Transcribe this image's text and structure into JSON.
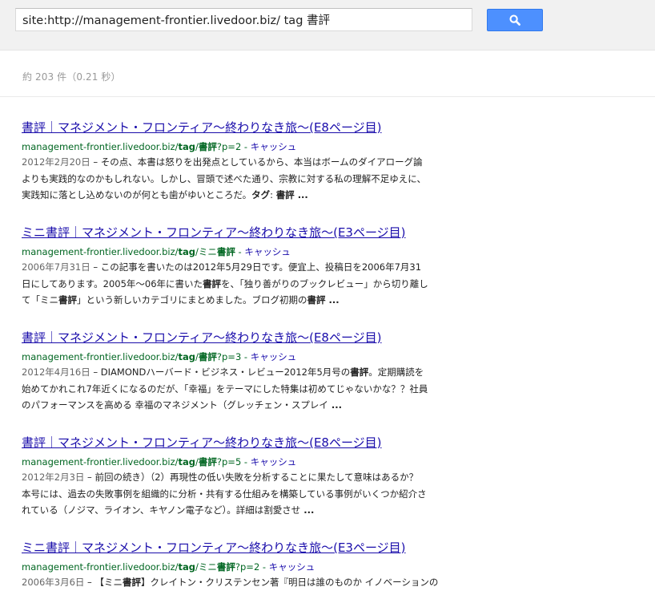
{
  "search": {
    "query": "site:http://management-frontier.livedoor.biz/ tag 書評",
    "button_icon": "search-icon"
  },
  "stats": {
    "text": "約 203 件（0.21 秒）"
  },
  "colors": {
    "link": "#1a0dab",
    "url": "#006621",
    "button": "#4d90fe"
  },
  "results": [
    {
      "title": "書評｜マネジメント・フロンティア～終わりなき旅～(E8ページ目)",
      "url_pre": "management-frontier.livedoor.biz/",
      "url_bold1": "tag",
      "url_mid": "/",
      "url_bold2": "書評",
      "url_post": "?p=2",
      "url_sep": " - ",
      "cache": "キャッシュ",
      "date": "2012年2月20日",
      "snippet_a": " – その点、本書は怒りを出発点としているから、本当はボームのダイアローグ論よりも実践的なのかもしれない。しかし、冒頭で述べた通り、宗教に対する私の理解不足ゆえに、実践知に落とし込めないのが何とも歯がゆいところだ。",
      "bold_a": "タグ",
      "snippet_b": ": ",
      "bold_b": "書評",
      "snippet_c": " ..."
    },
    {
      "title": "ミニ書評｜マネジメント・フロンティア～終わりなき旅～(E3ページ目)",
      "url_pre": "management-frontier.livedoor.biz/",
      "url_bold1": "tag",
      "url_mid": "/ミニ",
      "url_bold2": "書評",
      "url_post": "",
      "url_sep": " - ",
      "cache": "キャッシュ",
      "date": "2006年7月31日",
      "snippet_a": " – この記事を書いたのは2012年5月29日です。便宜上、投稿日を2006年7月31日にしてあります。2005年～06年に書いた",
      "bold_a": "書評",
      "snippet_b": "を、「独り善がりのブックレビュー」から切り離して「ミニ",
      "bold_b": "書評",
      "snippet_c": "」という新しいカテゴリにまとめました。ブログ初期の",
      "bold_c": "書評",
      "snippet_d": " ..."
    },
    {
      "title": "書評｜マネジメント・フロンティア～終わりなき旅～(E8ページ目)",
      "url_pre": "management-frontier.livedoor.biz/",
      "url_bold1": "tag",
      "url_mid": "/",
      "url_bold2": "書評",
      "url_post": "?p=3",
      "url_sep": " - ",
      "cache": "キャッシュ",
      "date": "2012年4月16日",
      "snippet_a": " – DIAMONDハーバード・ビジネス・レビュー2012年5月号の",
      "bold_a": "書評",
      "snippet_b": "。定期購読を始めてかれこれ7年近くになるのだが、「幸福」をテーマにした特集は初めてじゃないかな？？社員のパフォーマンスを高める 幸福のマネジメント（グレッチェン・スプレイ",
      "bold_b": "",
      "snippet_c": " ..."
    },
    {
      "title": "書評｜マネジメント・フロンティア～終わりなき旅～(E8ページ目)",
      "url_pre": "management-frontier.livedoor.biz/",
      "url_bold1": "tag",
      "url_mid": "/",
      "url_bold2": "書評",
      "url_post": "?p=5",
      "url_sep": " - ",
      "cache": "キャッシュ",
      "date": "2012年2月3日",
      "snippet_a": " – 前回の続き）（2）再現性の低い失敗を分析することに果たして意味はあるか？ 本号には、過去の失敗事例を組織的に分析・共有する仕組みを構築している事例がいくつか紹介されている（ノジマ、ライオン、キヤノン電子など）。詳細は割愛させ",
      "bold_a": "",
      "snippet_b": "",
      "bold_b": "",
      "snippet_c": " ..."
    },
    {
      "title": "ミニ書評｜マネジメント・フロンティア～終わりなき旅～(E3ページ目)",
      "url_pre": "management-frontier.livedoor.biz/",
      "url_bold1": "tag",
      "url_mid": "/ミニ",
      "url_bold2": "書評",
      "url_post": "?p=2",
      "url_sep": " - ",
      "cache": "キャッシュ",
      "date": "2006年3月6日",
      "snippet_a": " – 【ミニ",
      "bold_a": "書評",
      "snippet_b": "】クレイトン・クリステンセン著『明日は誰のものか イノベーションの",
      "bold_b": "",
      "snippet_c": ""
    }
  ]
}
